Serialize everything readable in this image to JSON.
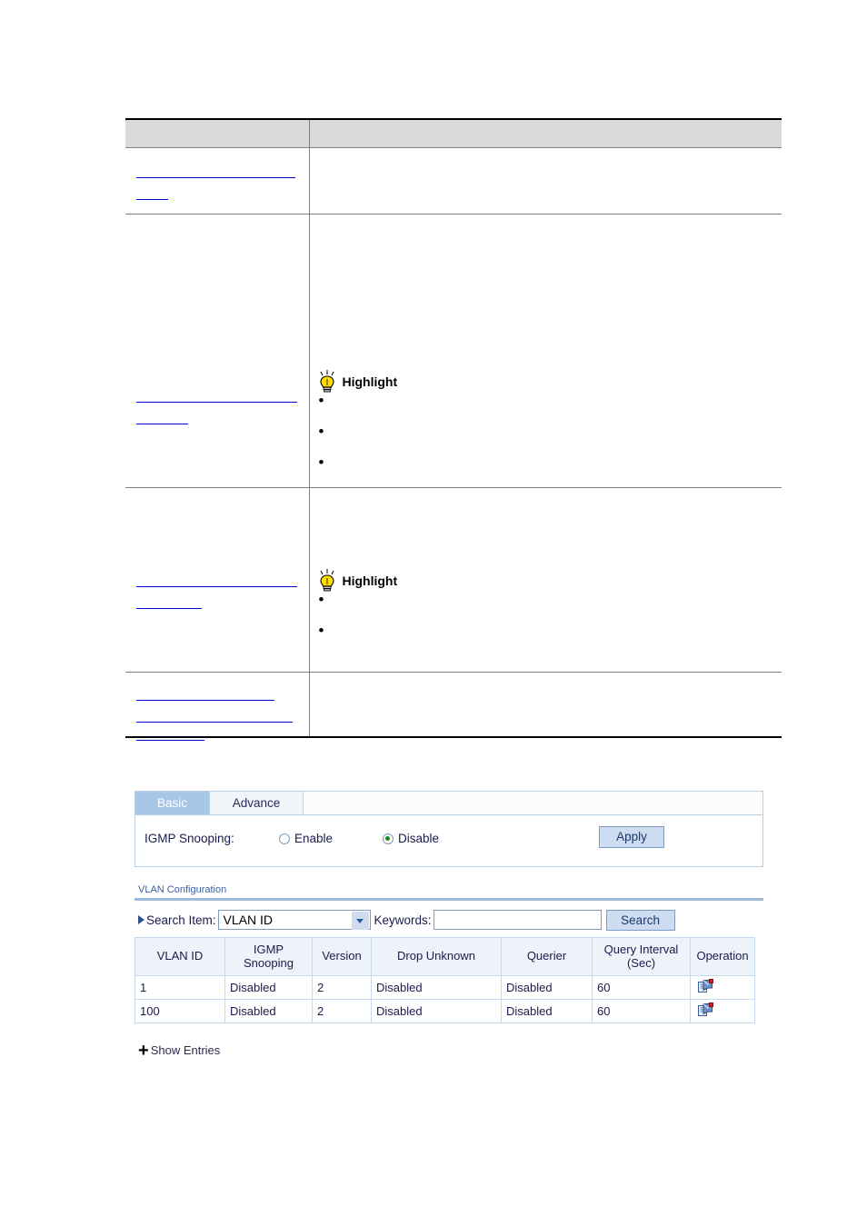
{
  "doc_table": {
    "header": {
      "col1": "",
      "col2": ""
    },
    "rows": [
      {
        "links": [
          "",
          ""
        ],
        "content_type": "plain",
        "right": ""
      },
      {
        "links": [
          "",
          ""
        ],
        "content_type": "highlight",
        "highlight_title": "Highlight",
        "bullets": [
          "",
          "",
          ""
        ]
      },
      {
        "links": [
          "",
          ""
        ],
        "content_type": "highlight",
        "highlight_title": "Highlight",
        "bullets": [
          "",
          ""
        ]
      },
      {
        "links": [
          "",
          ""
        ],
        "content_type": "plain",
        "right": ""
      }
    ]
  },
  "loose_link": {
    "label": ""
  },
  "webui": {
    "tabs": [
      {
        "label": "Basic",
        "active": true
      },
      {
        "label": "Advance",
        "active": false
      }
    ],
    "snooping": {
      "label": "IGMP Snooping:",
      "enable_label": "Enable",
      "disable_label": "Disable",
      "selected": "Disable",
      "apply_label": "Apply"
    },
    "vlan_section": {
      "title": "VLAN Configuration",
      "search_item_label": "Search Item:",
      "search_item_value": "VLAN ID",
      "search_item_options": [
        "VLAN ID"
      ],
      "keywords_label": "Keywords:",
      "keywords_value": "",
      "keywords_placeholder": "",
      "search_button_label": "Search",
      "table": {
        "columns": [
          "VLAN ID",
          "IGMP Snooping",
          "Version",
          "Drop Unknown",
          "Querier",
          "Query Interval (Sec)",
          "Operation"
        ],
        "columns_multiline": [
          [
            "VLAN ID"
          ],
          [
            "IGMP",
            "Snooping"
          ],
          [
            "Version"
          ],
          [
            "Drop Unknown"
          ],
          [
            "Querier"
          ],
          [
            "Query Interval",
            "(Sec)"
          ],
          [
            "Operation"
          ]
        ],
        "rows": [
          {
            "vlan_id": "1",
            "igmp_snooping": "Disabled",
            "version": "2",
            "drop_unknown": "Disabled",
            "querier": "Disabled",
            "query_interval": "60",
            "operation_icon": "edit-icon"
          },
          {
            "vlan_id": "100",
            "igmp_snooping": "Disabled",
            "version": "2",
            "drop_unknown": "Disabled",
            "querier": "Disabled",
            "query_interval": "60",
            "operation_icon": "edit-icon"
          }
        ]
      }
    },
    "show_entries": {
      "plus": "+",
      "label": "Show Entries"
    }
  },
  "colors": {
    "tab_active_bg": "#a8c6e8",
    "button_bg": "#cddcf0",
    "button_border": "#7b9dc4",
    "section_rule": "#9fb9da",
    "link_underline": "#0000cc",
    "table_header_bg": "#eef3f9",
    "doc_header_bg": "#d9d9d9",
    "radio_selected_dot": "#1a8a1a"
  }
}
